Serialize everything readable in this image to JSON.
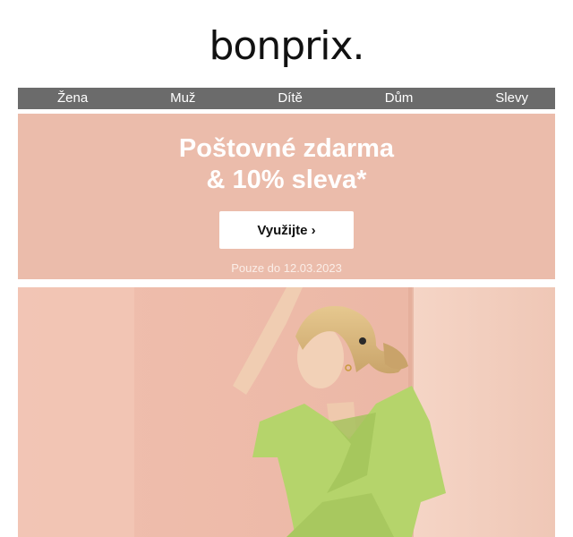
{
  "brand": {
    "logo_text": "bonprix."
  },
  "nav": {
    "items": [
      {
        "label": "Žena"
      },
      {
        "label": "Muž"
      },
      {
        "label": "Dítě"
      },
      {
        "label": "Dům"
      },
      {
        "label": "Slevy"
      }
    ]
  },
  "promo": {
    "headline_line1": "Poštovné zdarma",
    "headline_line2": "& 10% sleva*",
    "cta_label": "Využijte ›",
    "validity": "Pouze do 12.03.2023"
  },
  "colors": {
    "nav_bg": "#6b6b6b",
    "promo_bg": "#ebbcab",
    "dress_green": "#b5d46b"
  }
}
